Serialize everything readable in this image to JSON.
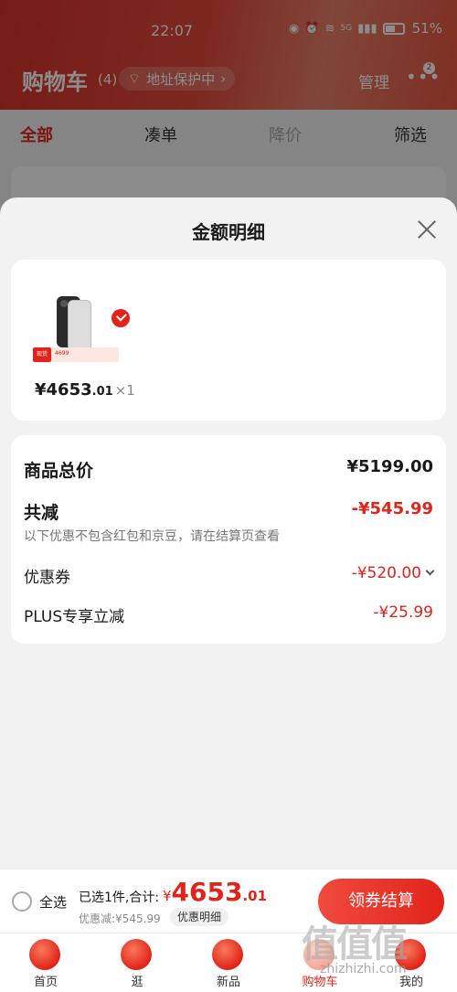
{
  "status_bar": {
    "time": "22:07",
    "signal": "5G",
    "battery": "51%"
  },
  "cart_header": {
    "title": "购物车",
    "count": "(4)",
    "address_chip": "地址保护中",
    "manage": "管理",
    "message_badge": "2"
  },
  "filter_tabs": {
    "all": "全部",
    "bundle": "凑单",
    "price_drop": "降价",
    "filter": "筛选"
  },
  "sheet": {
    "title": "金额明细",
    "product": {
      "tag": "现货",
      "price_int": "¥4653",
      "price_dec": ".01",
      "qty": "×1",
      "strip_price": "4699"
    },
    "summary": {
      "total_label": "商品总价",
      "total_value": "¥5199.00",
      "reduce_label": "共减",
      "reduce_value": "-¥545.99",
      "note": "以下优惠不包含红包和京豆，请在结算页查看",
      "coupon_label": "优惠券",
      "coupon_value": "-¥520.00",
      "plus_label": "PLUS专享立减",
      "plus_value": "-¥25.99"
    }
  },
  "checkout": {
    "select_all": "全选",
    "selected_info": "已选1件,合计:",
    "total_sym": "¥",
    "total_int": "4653",
    "total_dec": ".01",
    "discount": "优惠减:¥545.99",
    "detail_chip": "优惠明细",
    "button": "领券结算"
  },
  "tabbar": {
    "home": "首页",
    "browse": "逛",
    "new": "新品",
    "cart": "购物车",
    "mine": "我的"
  },
  "watermark": {
    "main": "值值值",
    "sub": "zhizhizhi.com"
  },
  "colors": {
    "accent": "#e2231a",
    "header_start": "#d8342c"
  }
}
